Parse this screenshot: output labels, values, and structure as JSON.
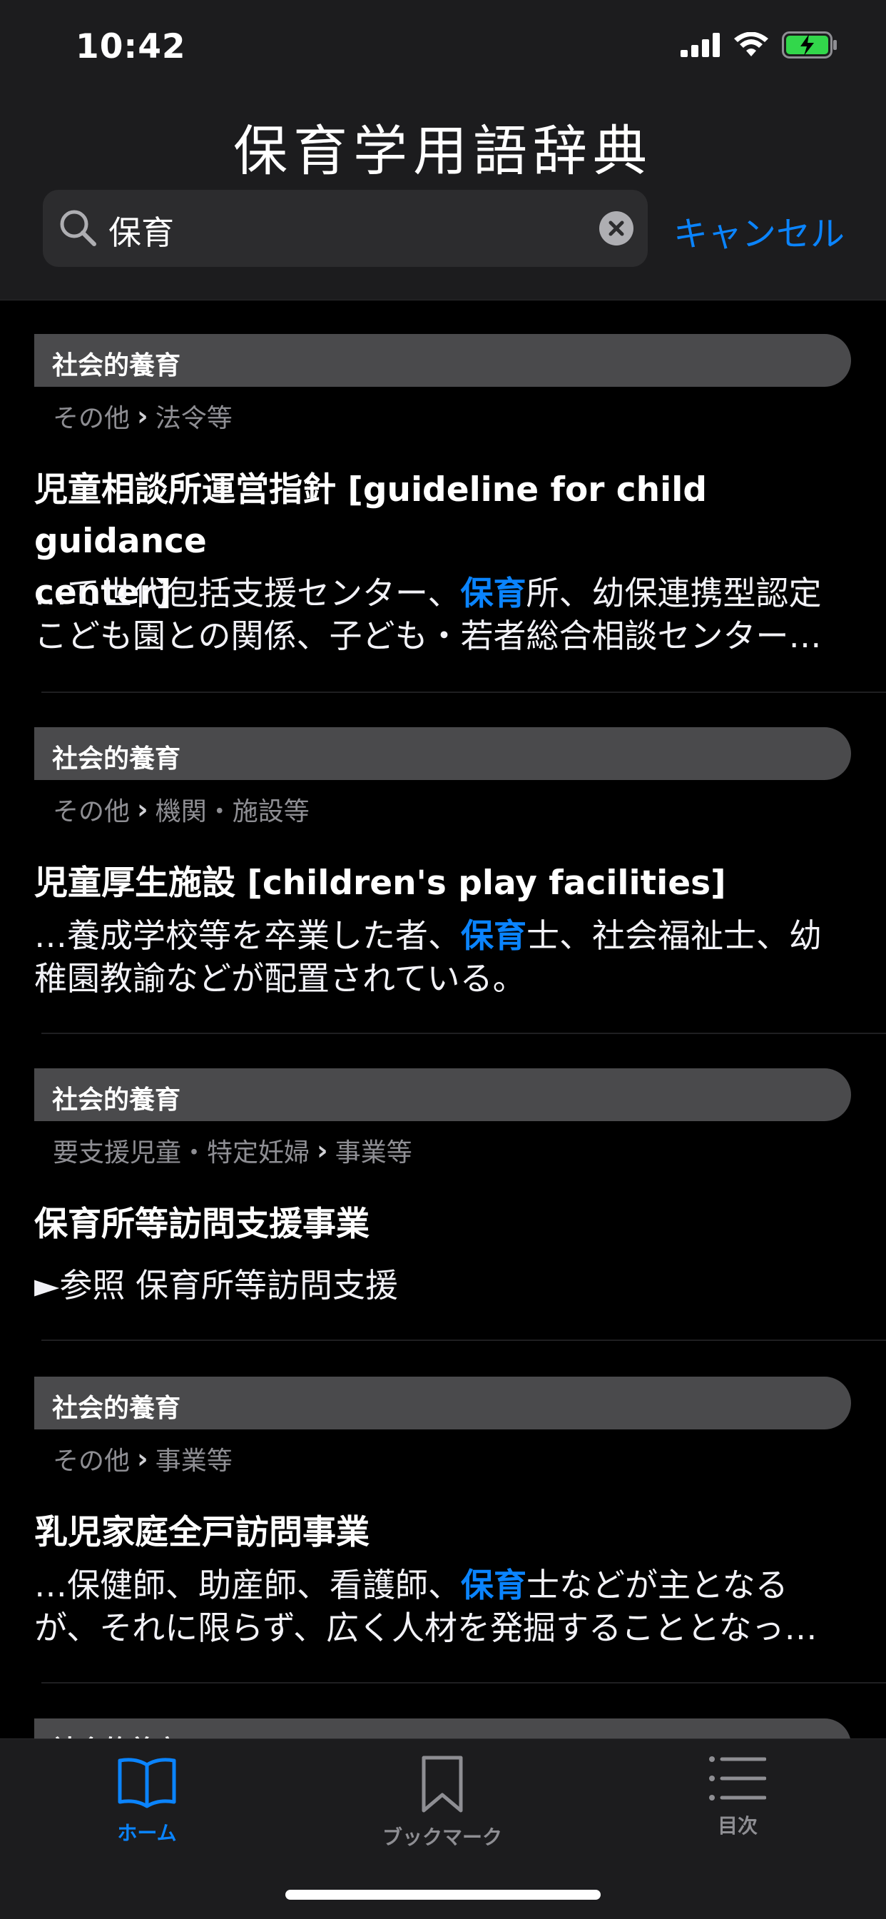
{
  "status_bar": {
    "time": "10:42"
  },
  "header": {
    "title": "保育学用語辞典"
  },
  "search": {
    "query": "保育",
    "cancel_label": "キャンセル"
  },
  "results": [
    {
      "category": "社会的養育",
      "breadcrumb": [
        "その他",
        "法令等"
      ],
      "title_lines": [
        "児童相談所運営指針 [guideline for child guidance",
        "center]"
      ],
      "snippet_lines": [
        {
          "before": "…て世代包括支援センター、",
          "highlight": "保育",
          "after": "所、幼保連携型認定"
        },
        {
          "before": "こども園との関係、子ども・若者総合相談センター…",
          "highlight": "",
          "after": ""
        }
      ]
    },
    {
      "category": "社会的養育",
      "breadcrumb": [
        "その他",
        "機関・施設等"
      ],
      "title_lines": [
        "児童厚生施設 [children's play facilities]"
      ],
      "snippet_lines": [
        {
          "before": "…養成学校等を卒業した者、",
          "highlight": "保育",
          "after": "士、社会福祉士、幼"
        },
        {
          "before": "稚園教諭などが配置されている。",
          "highlight": "",
          "after": ""
        }
      ]
    },
    {
      "category": "社会的養育",
      "breadcrumb": [
        "要支援児童・特定妊婦",
        "事業等"
      ],
      "title_lines": [
        "保育所等訪問支援事業"
      ],
      "snippet_lines": [
        {
          "before": "►参照 保育所等訪問支援",
          "highlight": "",
          "after": ""
        }
      ]
    },
    {
      "category": "社会的養育",
      "breadcrumb": [
        "その他",
        "事業等"
      ],
      "title_lines": [
        "乳児家庭全戸訪問事業"
      ],
      "snippet_lines": [
        {
          "before": "…保健師、助産師、看護師、",
          "highlight": "保育",
          "after": "士などが主となる"
        },
        {
          "before": "が、それに限らず、広く人材を発掘することとなっ…",
          "highlight": "",
          "after": ""
        }
      ]
    },
    {
      "category": "社会的養育",
      "breadcrumb": [],
      "title_lines": [],
      "snippet_lines": []
    }
  ],
  "tab_bar": {
    "tabs": [
      {
        "label": "ホーム",
        "icon": "book-icon",
        "active": true
      },
      {
        "label": "ブックマーク",
        "icon": "bookmark-icon",
        "active": false
      },
      {
        "label": "目次",
        "icon": "list-icon",
        "active": false
      }
    ]
  },
  "colors": {
    "accent": "#0a84ff",
    "background": "#000000",
    "bar_background": "#1c1c1e",
    "pill": "#4a4a4c",
    "muted": "#8e8e93"
  }
}
